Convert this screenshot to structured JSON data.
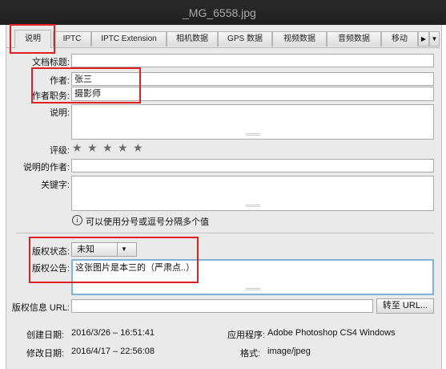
{
  "window": {
    "title": "_MG_6558.jpg"
  },
  "tabs": [
    {
      "label": "说明"
    },
    {
      "label": "IPTC"
    },
    {
      "label": "IPTC Extension"
    },
    {
      "label": "相机数据"
    },
    {
      "label": "GPS 数据"
    },
    {
      "label": "视频数据"
    },
    {
      "label": "音频数据"
    },
    {
      "label": "移动"
    }
  ],
  "tab_menu": {
    "arrow": "▶",
    "dropdown": "▼"
  },
  "fields": {
    "doc_title": {
      "label": "文档标题:",
      "value": ""
    },
    "author": {
      "label": "作者:",
      "value": "张三"
    },
    "author_title": {
      "label": "作者职务:",
      "value": "摄影师"
    },
    "description": {
      "label": "说明:",
      "value": ""
    },
    "rating": {
      "label": "评级:",
      "stars": 5,
      "filled": 0
    },
    "description_writer": {
      "label": "说明的作者:",
      "value": ""
    },
    "keywords": {
      "label": "关键字:",
      "value": ""
    },
    "keywords_hint": "可以使用分号或逗号分隔多个值",
    "copyright_status": {
      "label": "版权状态:",
      "value": "未知"
    },
    "copyright_notice": {
      "label": "版权公告:",
      "value": "这张图片是本三的（严肃点..）"
    },
    "copyright_url": {
      "label": "版权信息 URL:",
      "value": "",
      "button": "转至 URL..."
    }
  },
  "info": {
    "created_label": "创建日期:",
    "created_value": "2016/3/26 – 16:51:41",
    "modified_label": "修改日期:",
    "modified_value": "2016/4/17 – 22:56:08",
    "app_label": "应用程序:",
    "app_value": "Adobe Photoshop CS4 Windows",
    "format_label": "格式:",
    "format_value": "image/jpeg"
  },
  "colors": {
    "highlight": "#e02020",
    "focus_border": "#7fb2d8"
  }
}
